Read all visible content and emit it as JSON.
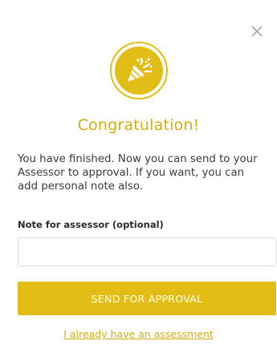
{
  "dialog": {
    "close_icon": "close-icon",
    "badge_icon": "party-popper-icon",
    "title": "Congratulation!",
    "message": "You have finished. Now you can send to your Assessor to approval. If you want, you can add personal note also.",
    "note_label": "Note for assessor (optional)",
    "note_value": "",
    "note_placeholder": "",
    "submit_label": "SEND FOR APPROVAL",
    "alt_link": "I already have an assessment"
  },
  "colors": {
    "accent": "#e2bd16",
    "accent_text": "#d4ac0d",
    "border": "#d9d9d9"
  }
}
